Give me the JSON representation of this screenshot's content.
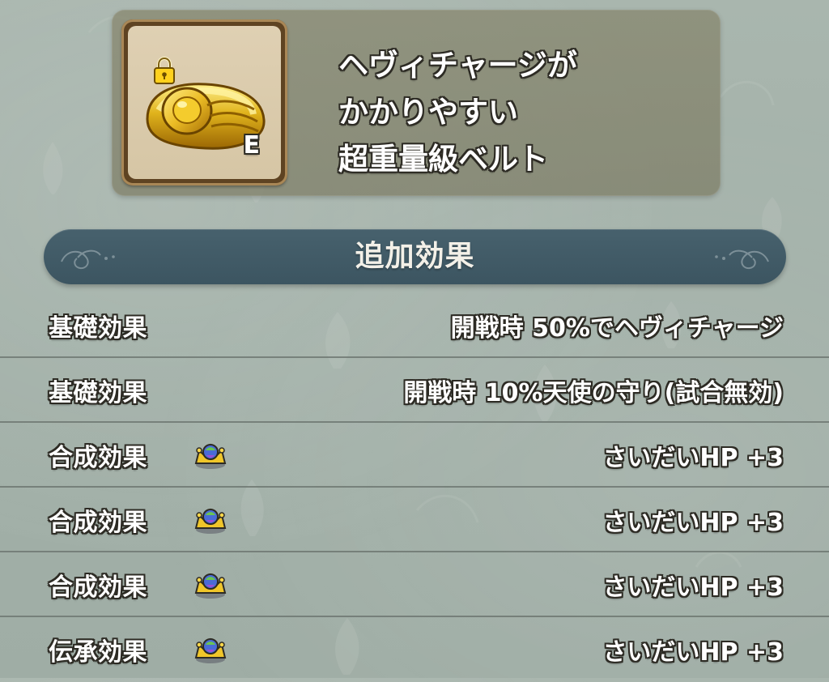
{
  "item": {
    "name_lines": [
      "ヘヴィチャージが",
      "かかりやすい",
      "超重量級ベルト"
    ],
    "equipped_badge": "E",
    "icon": "gold-belt-icon",
    "lock_icon": "padlock-icon"
  },
  "section": {
    "title": "追加効果"
  },
  "effects": [
    {
      "type": "基礎効果",
      "value": "開戦時 50%でヘヴィチャージ",
      "icon": ""
    },
    {
      "type": "基礎効果",
      "value": "開戦時 10%天使の守り(試合無効)",
      "icon": ""
    },
    {
      "type": "合成効果",
      "value": "さいだいHP +3",
      "icon": "crown-gem-icon"
    },
    {
      "type": "合成効果",
      "value": "さいだいHP +3",
      "icon": "crown-gem-icon"
    },
    {
      "type": "合成効果",
      "value": "さいだいHP +3",
      "icon": "crown-gem-icon"
    },
    {
      "type": "伝承効果",
      "value": "さいだいHP +3",
      "icon": "crown-gem-icon"
    }
  ],
  "colors": {
    "background": "#a3b1a9",
    "banner": "#3f5864",
    "item_card": "#888870",
    "divider": "#6e7872",
    "text_outline": "#2d2b24"
  }
}
